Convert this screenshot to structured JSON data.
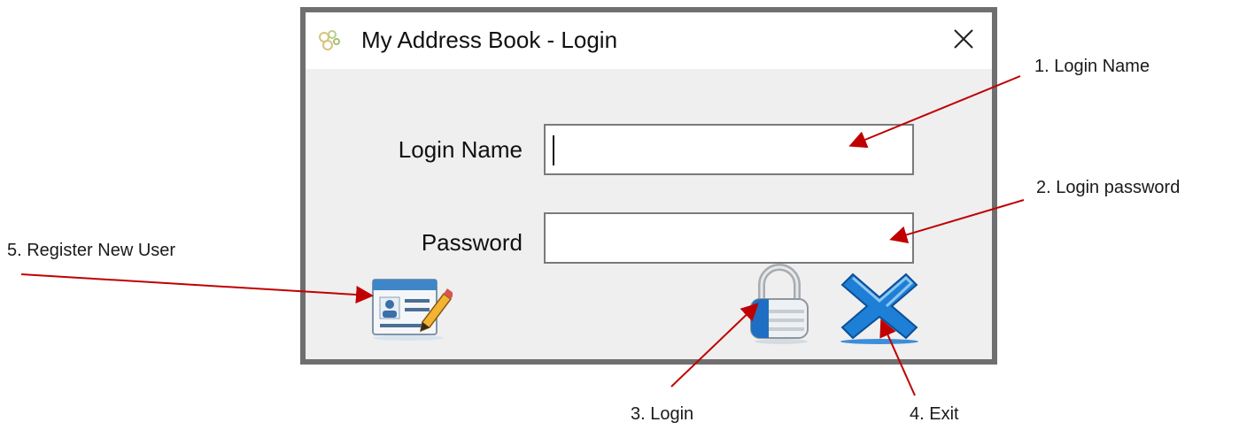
{
  "window": {
    "title": "My Address Book - Login",
    "icon": "address-book-app-icon",
    "close_icon": "close-icon"
  },
  "form": {
    "login_name_label": "Login Name",
    "login_name_value": "",
    "password_label": "Password",
    "password_value": ""
  },
  "buttons": {
    "register_icon": "contact-card-pencil-icon",
    "login_icon": "padlock-icon",
    "exit_icon": "blue-x-icon"
  },
  "callouts": {
    "login_name": "1. Login Name",
    "login_password": "2. Login password",
    "login": "3. Login",
    "exit": "4. Exit",
    "register": "5. Register New User"
  },
  "colors": {
    "arrow": "#c00000",
    "window_border": "#6f6f6f",
    "window_background": "#efefef",
    "exit_blue": "#1e7fd6"
  }
}
